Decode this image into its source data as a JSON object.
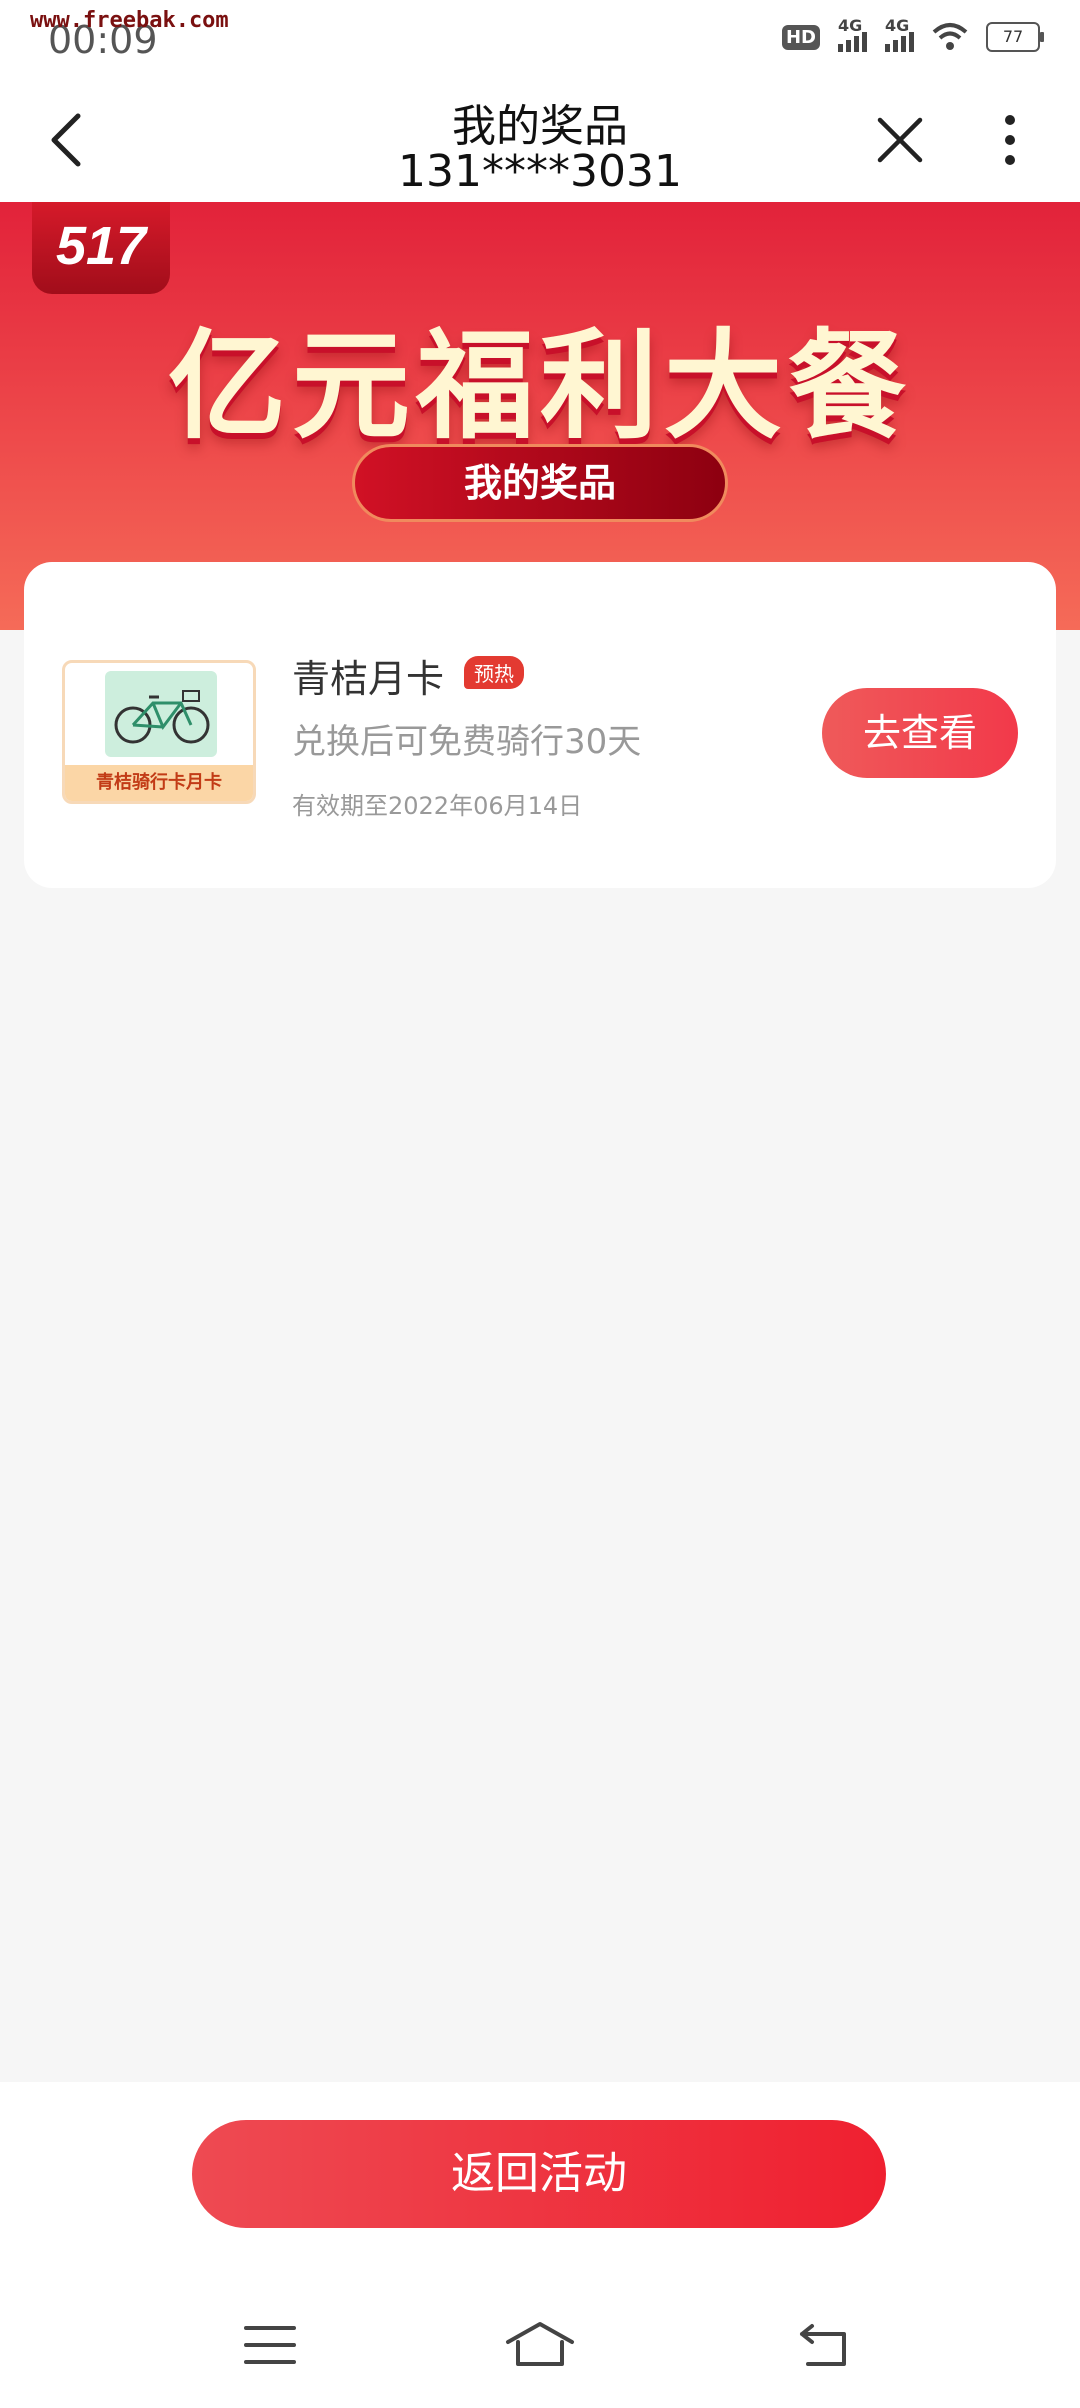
{
  "status_bar": {
    "watermark": "www.freebak.com",
    "time": "00:09",
    "hd_label": "HD",
    "sim1_network": "4G",
    "sim2_network": "4G",
    "battery": "77",
    "icons": [
      "hd-icon",
      "signal-icon",
      "signal-icon",
      "wifi-icon",
      "battery-icon"
    ]
  },
  "nav": {
    "title": "我的奖品",
    "subtitle": "131****3031",
    "icons": [
      "back-arrow-icon",
      "close-icon",
      "more-vertical-icon"
    ]
  },
  "hero": {
    "badge": "517",
    "title": "亿元福利大餐",
    "pill_label": "我的奖品"
  },
  "prize": {
    "thumb_label": "青桔骑行卡月卡",
    "name": "青桔月卡",
    "tag": "预热",
    "description": "兑换后可免费骑行30天",
    "expiry": "有效期至2022年06月14日",
    "action_label": "去查看"
  },
  "footer": {
    "return_label": "返回活动"
  },
  "system_nav": {
    "icons": [
      "menu-icon",
      "home-icon",
      "back-icon"
    ]
  },
  "colors": {
    "brand_red": "#e2223a",
    "button_red": "#ef2030",
    "tag_red": "#e33a31"
  }
}
